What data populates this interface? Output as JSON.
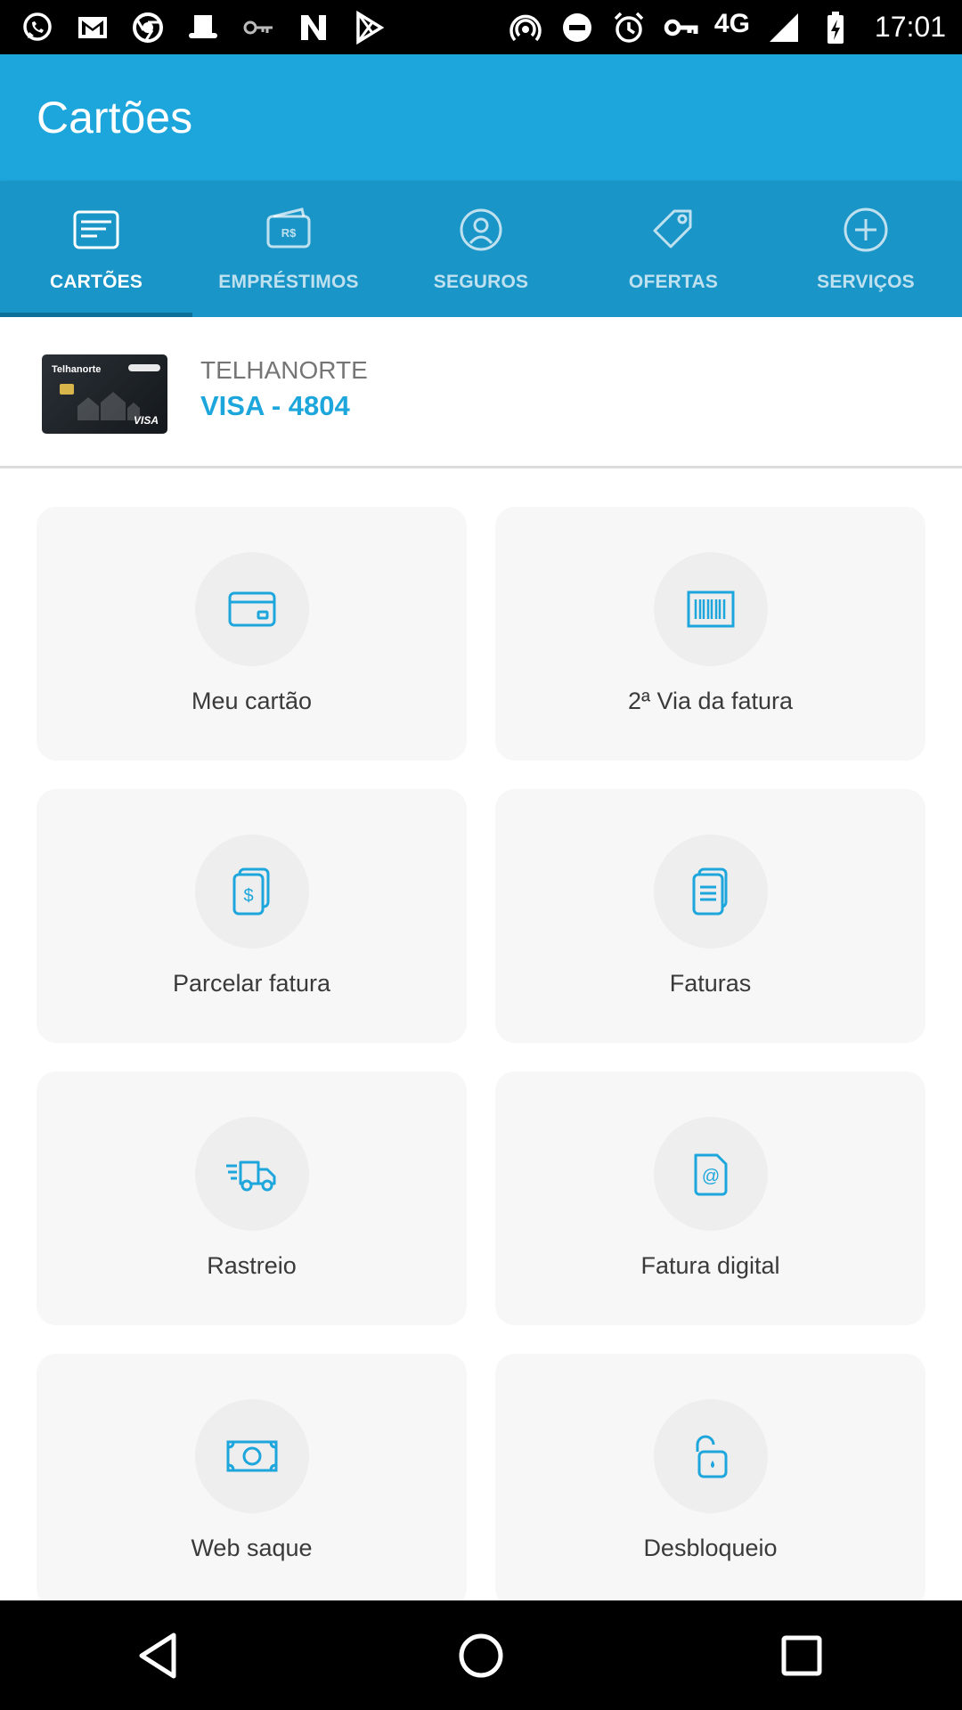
{
  "status_bar": {
    "left_icons": [
      "whatsapp-icon",
      "gmail-icon",
      "chrome-icon",
      "hat-icon",
      "key-icon",
      "n-app-icon",
      "play-store-icon"
    ],
    "right_icons": [
      "hotspot-icon",
      "do-not-disturb-icon",
      "alarm-icon",
      "vpn-key-icon"
    ],
    "network": "4G",
    "time": "17:01"
  },
  "app_bar": {
    "title": "Cartões"
  },
  "tabs": [
    {
      "label": "CARTÕES",
      "icon": "card-list-icon",
      "active": true
    },
    {
      "label": "EMPRÉSTIMOS",
      "icon": "wallet-icon",
      "active": false
    },
    {
      "label": "SEGUROS",
      "icon": "person-shield-icon",
      "active": false
    },
    {
      "label": "OFERTAS",
      "icon": "tag-icon",
      "active": false
    },
    {
      "label": "SERVIÇOS",
      "icon": "plus-circle-icon",
      "active": false
    }
  ],
  "selected_card": {
    "issuer": "TELHANORTE",
    "number": "VISA - 4804",
    "thumb_brand": "Telhanorte",
    "thumb_network": "VISA"
  },
  "tiles": [
    {
      "label": "Meu cartão",
      "icon": "credit-card-icon"
    },
    {
      "label": "2ª Via da fatura",
      "icon": "barcode-icon"
    },
    {
      "label": "Parcelar fatura",
      "icon": "dollar-document-icon"
    },
    {
      "label": "Faturas",
      "icon": "documents-icon"
    },
    {
      "label": "Rastreio",
      "icon": "delivery-truck-icon"
    },
    {
      "label": "Fatura digital",
      "icon": "email-document-icon"
    },
    {
      "label": "Web saque",
      "icon": "banknote-icon"
    },
    {
      "label": "Desbloqueio",
      "icon": "unlock-icon"
    }
  ],
  "nav_bar": [
    "back-icon",
    "home-icon",
    "recents-icon"
  ],
  "colors": {
    "app_bar": "#1da6dc",
    "tab_bar": "#1a95c7",
    "tab_indicator": "#0e6f98",
    "accent": "#1da6dc",
    "tile_bg": "#f7f7f7",
    "icon_circle": "#eeeeee"
  }
}
